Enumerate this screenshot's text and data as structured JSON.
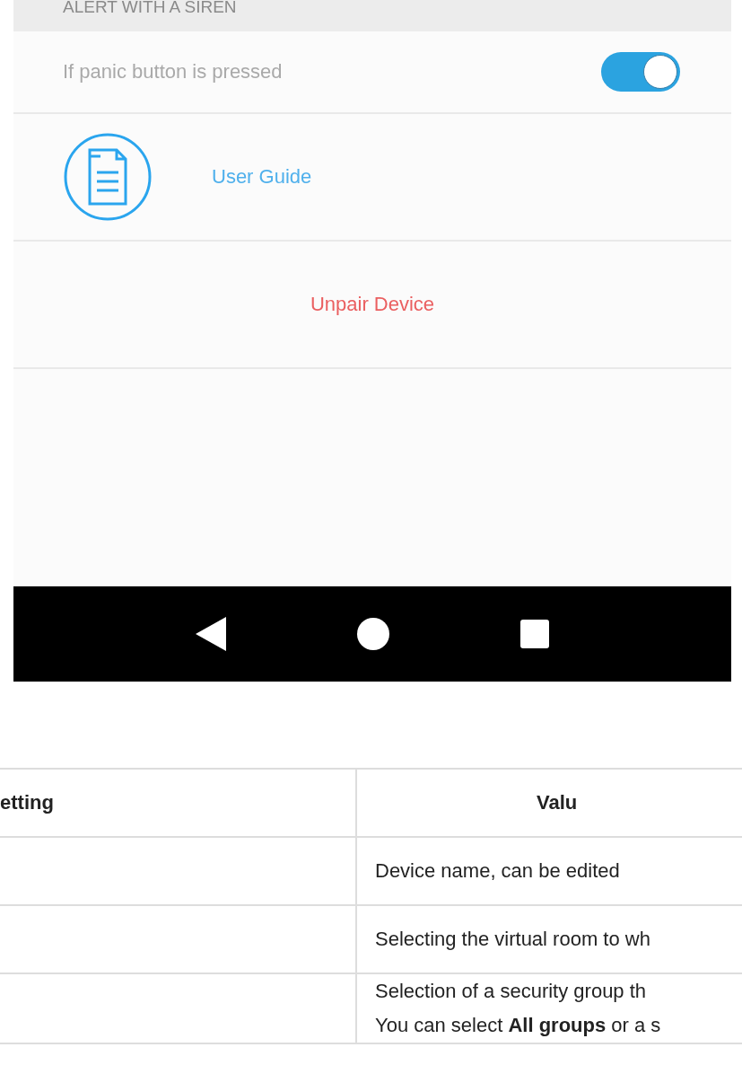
{
  "phone": {
    "section_header": "ALERT WITH A SIREN",
    "toggles": [
      {
        "label": "If panic button is pressed",
        "on": true
      }
    ],
    "guide_link": "User Guide",
    "unpair_button": "Unpair Device"
  },
  "table": {
    "columns": [
      "etting",
      "Valu"
    ],
    "rows": [
      {
        "cells": [
          "",
          "Device name, can be edited"
        ]
      },
      {
        "cells": [
          "",
          "Selecting the virtual room to wh"
        ]
      },
      {
        "cells": [
          "",
          "Selection of a security group th",
          "You can select **All groups** or a s"
        ]
      }
    ]
  }
}
